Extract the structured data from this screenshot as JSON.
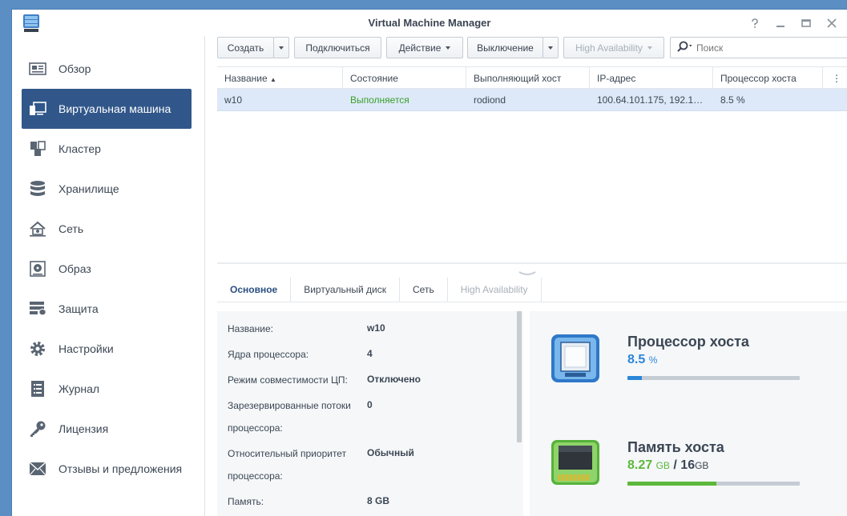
{
  "window": {
    "title": "Virtual Machine Manager"
  },
  "sidebar": {
    "items": [
      {
        "label": "Обзор",
        "icon": "overview-icon"
      },
      {
        "label": "Виртуальная машина",
        "icon": "vm-icon",
        "active": true
      },
      {
        "label": "Кластер",
        "icon": "cluster-icon"
      },
      {
        "label": "Хранилище",
        "icon": "storage-icon"
      },
      {
        "label": "Сеть",
        "icon": "network-icon"
      },
      {
        "label": "Образ",
        "icon": "image-icon"
      },
      {
        "label": "Защита",
        "icon": "protection-icon"
      },
      {
        "label": "Настройки",
        "icon": "gear-icon"
      },
      {
        "label": "Журнал",
        "icon": "log-icon"
      },
      {
        "label": "Лицензия",
        "icon": "key-icon"
      },
      {
        "label": "Отзывы и предложения",
        "icon": "mail-icon"
      }
    ]
  },
  "toolbar": {
    "create": "Создать",
    "connect": "Подключиться",
    "action": "Действие",
    "shutdown": "Выключение",
    "high_availability": "High Availability",
    "search_placeholder": "Поиск"
  },
  "grid": {
    "columns": [
      "Название",
      "Состояние",
      "Выполняющий хост",
      "IP-адрес",
      "Процессор хоста"
    ],
    "rows": [
      {
        "name": "w10",
        "state": "Выполняется",
        "host": "rodiond",
        "ip": "100.64.101.175, 192.1…",
        "cpu": "8.5 %"
      }
    ]
  },
  "tabs": [
    "Основное",
    "Виртуальный диск",
    "Сеть",
    "High Availability"
  ],
  "details": [
    {
      "label": "Название:",
      "value": "w10"
    },
    {
      "label": "Ядра процессора:",
      "value": "4"
    },
    {
      "label": "Режим совместимости ЦП:",
      "value": "Отключено"
    },
    {
      "label": "Зарезервированные потоки",
      "label2": "процессора:",
      "value": "0"
    },
    {
      "label": "Относительный приоритет",
      "label2": "процессора:",
      "value": "Обычный"
    },
    {
      "label": "Память:",
      "value": "8 GB"
    }
  ],
  "stats": {
    "cpu": {
      "title": "Процессор хоста",
      "value": "8.5",
      "unit": "%",
      "fraction": 0.085,
      "color": "#2b86d9"
    },
    "memory": {
      "title": "Память хоста",
      "used": "8.27",
      "used_unit": "GB",
      "sep": "/",
      "total": "16",
      "total_unit": "GB",
      "fraction": 0.517,
      "color": "#5cb83a"
    }
  }
}
